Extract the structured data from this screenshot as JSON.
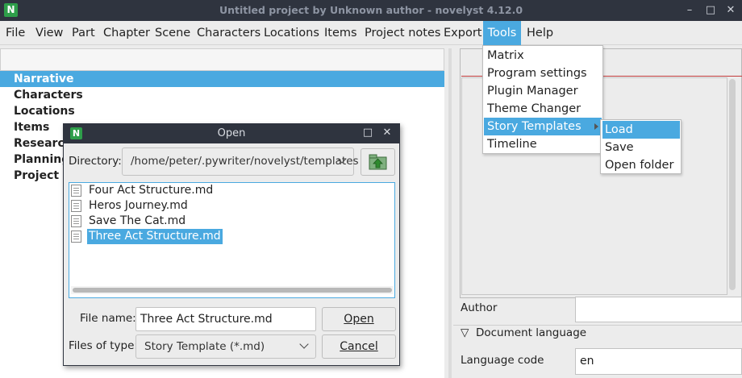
{
  "window": {
    "title": "Untitled project by Unknown author - novelyst 4.12.0",
    "app_icon": "N",
    "minimize": "–",
    "restore": "□",
    "close": "✕"
  },
  "menubar": {
    "items": [
      "File",
      "View",
      "Part",
      "Chapter",
      "Scene",
      "Characters",
      "Locations",
      "Items",
      "Project notes",
      "Export",
      "Tools",
      "Help"
    ],
    "active": "Tools"
  },
  "tree": {
    "items": [
      "Narrative",
      "Characters",
      "Locations",
      "Items",
      "Research",
      "Planning",
      "Project notes"
    ],
    "selected": "Narrative"
  },
  "tools_menu": {
    "items": [
      "Matrix",
      "Program settings",
      "Plugin Manager",
      "Theme Changer",
      "Story Templates",
      "Timeline"
    ],
    "highlighted": "Story Templates"
  },
  "story_templates_submenu": {
    "items": [
      "Load",
      "Save",
      "Open folder"
    ],
    "highlighted": "Load"
  },
  "right_panel": {
    "author_label": "Author",
    "author_value": "",
    "document_language_header": "Document language",
    "language_code_label": "Language code",
    "language_code_value": "en"
  },
  "open_dialog": {
    "title": "Open",
    "directory_label": "Directory:",
    "directory_value": "/home/peter/.pywriter/novelyst/templates",
    "files": [
      "Four Act Structure.md",
      "Heros Journey.md",
      "Save The Cat.md",
      "Three Act Structure.md"
    ],
    "selected_file": "Three Act Structure.md",
    "file_name_label": "File name:",
    "file_name_value": "Three Act Structure.md",
    "files_of_type_label": "Files of type:",
    "files_of_type_value": "Story Template (*.md)",
    "open_button": "Open",
    "cancel_button": "Cancel"
  },
  "colors": {
    "accent": "#4aa9e0",
    "titlebar": "#2f343f",
    "app_icon": "#2e9e4a"
  }
}
